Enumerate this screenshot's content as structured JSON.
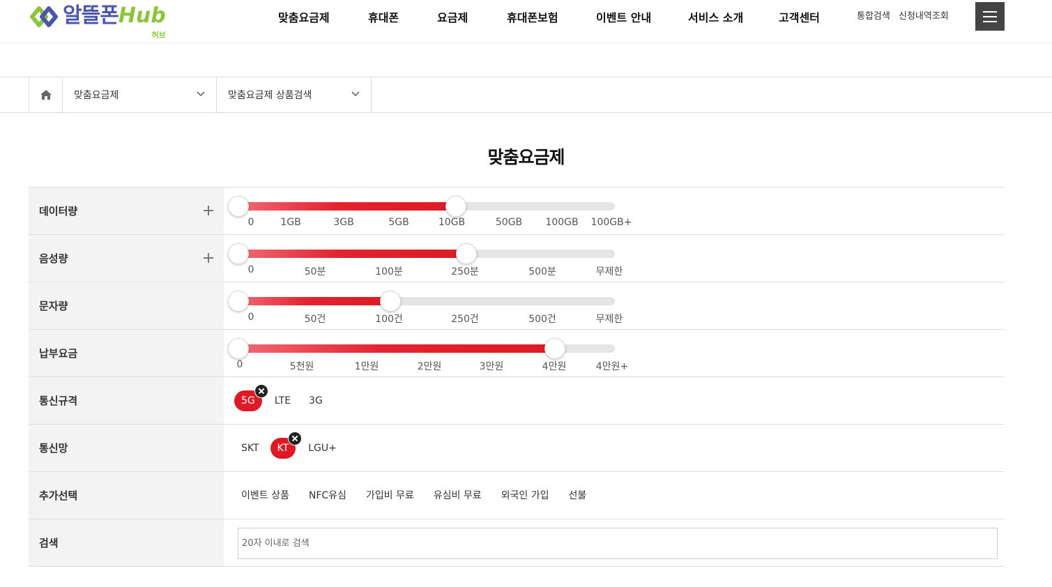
{
  "header": {
    "logo_text": "알뜰폰",
    "logo_hub": "Hub",
    "logo_sub": "허브",
    "nav": [
      "맞춤요금제",
      "휴대폰",
      "요금제",
      "휴대폰보험",
      "이벤트 안내",
      "서비스 소개",
      "고객센터"
    ],
    "util": [
      "통합검색",
      "신청내역조회"
    ]
  },
  "breadcrumb": {
    "level1": "맞춤요금제",
    "level2": "맞춤요금제 상품검색"
  },
  "page_title": "맞춤요금제",
  "filters": {
    "data": {
      "label": "데이터량",
      "ticks": [
        "0",
        "1GB",
        "3GB",
        "5GB",
        "10GB",
        "50GB",
        "100GB",
        "100GB+"
      ],
      "selected_from": "0",
      "selected_to": "10GB"
    },
    "voice": {
      "label": "음성량",
      "ticks": [
        "0",
        "50분",
        "100분",
        "250분",
        "500분",
        "무제한"
      ],
      "selected_from": "0",
      "selected_to": "250분"
    },
    "sms": {
      "label": "문자량",
      "ticks": [
        "0",
        "50건",
        "100건",
        "250건",
        "500건",
        "무제한"
      ],
      "selected_from": "0",
      "selected_to": "100건"
    },
    "fee": {
      "label": "납부요금",
      "ticks": [
        "0",
        "5천원",
        "1만원",
        "2만원",
        "3만원",
        "4만원",
        "4만원+"
      ],
      "selected_from": "0",
      "selected_to": "4만원"
    },
    "standard": {
      "label": "통신규격",
      "options": [
        "5G",
        "LTE",
        "3G"
      ],
      "selected": [
        "5G"
      ]
    },
    "network": {
      "label": "통신망",
      "options": [
        "SKT",
        "KT",
        "LGU+"
      ],
      "selected": [
        "KT"
      ]
    },
    "extra": {
      "label": "추가선택",
      "options": [
        "이벤트 상품",
        "NFC유심",
        "가입비 무료",
        "유심비 무료",
        "외국인 가입",
        "선불"
      ],
      "selected": []
    },
    "search": {
      "label": "검색",
      "placeholder": "20자 이내로 검색",
      "value": ""
    }
  },
  "colors": {
    "accent": "#dd1a26",
    "logo_blue": "#4a57a8",
    "logo_green": "#8cc43d"
  }
}
